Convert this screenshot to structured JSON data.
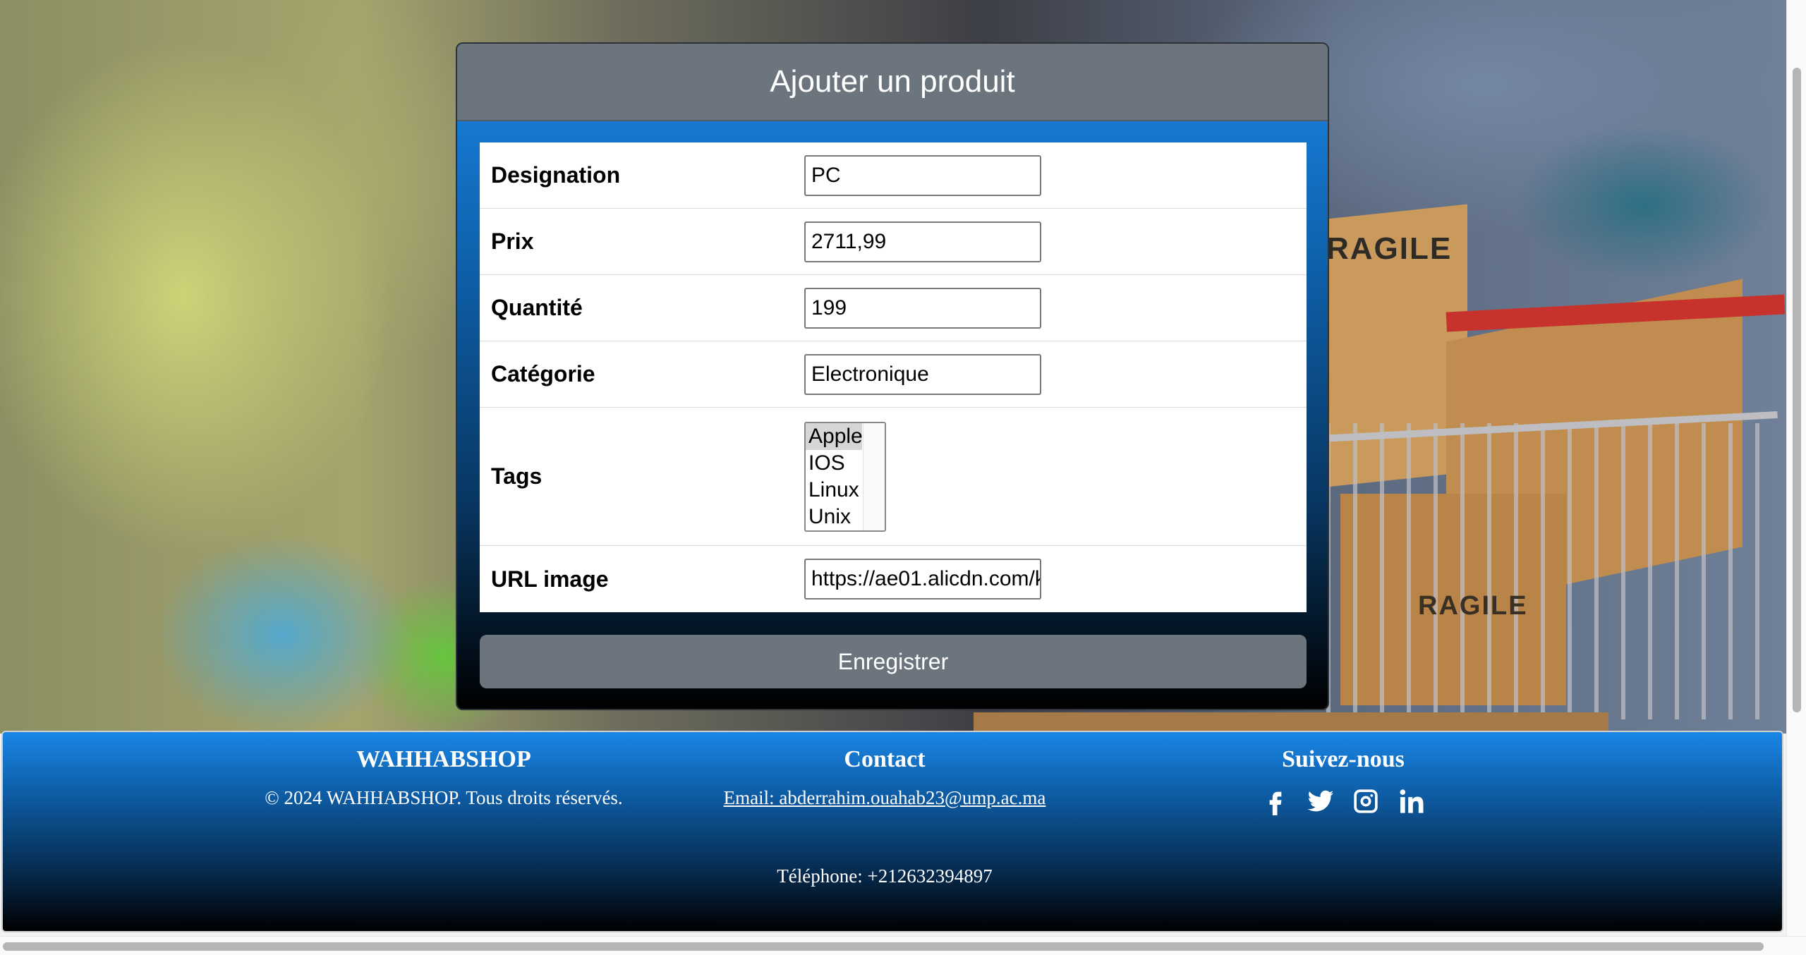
{
  "form": {
    "title": "Ajouter un produit",
    "fields": {
      "designation": {
        "label": "Designation",
        "value": "PC"
      },
      "prix": {
        "label": "Prix",
        "value": "2711,99"
      },
      "quantite": {
        "label": "Quantité",
        "value": "199"
      },
      "categorie": {
        "label": "Catégorie",
        "value": "Electronique"
      },
      "tags": {
        "label": "Tags",
        "options": [
          "Apple",
          "IOS",
          "Linux",
          "Unix"
        ],
        "selected": "Apple"
      },
      "url_image": {
        "label": "URL image",
        "value": "https://ae01.alicdn.com/k"
      }
    },
    "submit_label": "Enregistrer"
  },
  "footer": {
    "brand": {
      "title": "WAHHABSHOP",
      "copyright": "© 2024 WAHHABSHOP. Tous droits réservés."
    },
    "contact": {
      "title": "Contact",
      "email": "Email: abderrahim.ouahab23@ump.ac.ma",
      "phone": "Téléphone: +212632394897"
    },
    "social": {
      "title": "Suivez-nous",
      "icons": [
        "facebook-icon",
        "twitter-icon",
        "instagram-icon",
        "linkedin-icon"
      ]
    }
  },
  "background_text": {
    "box_top": "RAGILE",
    "box_bottom": "RAGILE"
  },
  "colors": {
    "header_gray": "#6c757d",
    "gradient_blue": "#1a86e6",
    "gradient_dark": "#000000",
    "button_gray": "#6c757d"
  }
}
